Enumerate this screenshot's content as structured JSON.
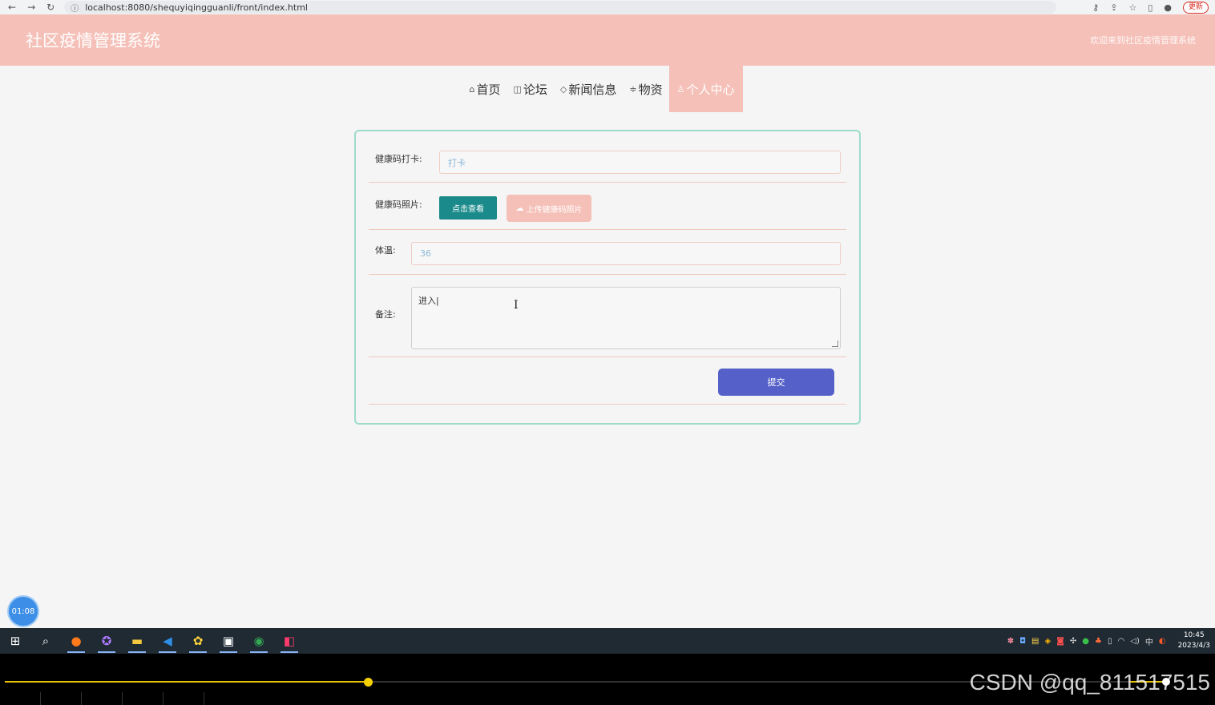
{
  "browser": {
    "url": "localhost:8080/shequyiqingguanli/front/index.html",
    "update_label": "更新"
  },
  "header": {
    "title": "社区疫情管理系统",
    "welcome": "欢迎来到社区疫情管理系统"
  },
  "nav": {
    "items": [
      {
        "label": "首页",
        "icon": "⌂"
      },
      {
        "label": "论坛",
        "icon": "◫"
      },
      {
        "label": "新闻信息",
        "icon": "◇"
      },
      {
        "label": "物资",
        "icon": "≑"
      },
      {
        "label": "个人中心",
        "icon": "♙"
      }
    ]
  },
  "form": {
    "checkin_label": "健康码打卡:",
    "checkin_placeholder": "打卡",
    "photo_label": "健康码照片:",
    "view_button": "点击查看",
    "upload_button": "上传健康码照片",
    "temp_label": "体温:",
    "temp_value": "36",
    "remark_label": "备注:",
    "remark_value": "进入",
    "submit_button": "提交"
  },
  "recorder": {
    "elapsed": "01:08"
  },
  "taskbar": {
    "time": "10:45",
    "date": "2023/4/3",
    "ime": "中"
  },
  "watermark": "CSDN @qq_811517515",
  "colors": {
    "header_bg": "#f5c0b8",
    "card_border": "#9ddbcb",
    "view_btn": "#1a8a8a",
    "submit_btn": "#5561c8"
  }
}
